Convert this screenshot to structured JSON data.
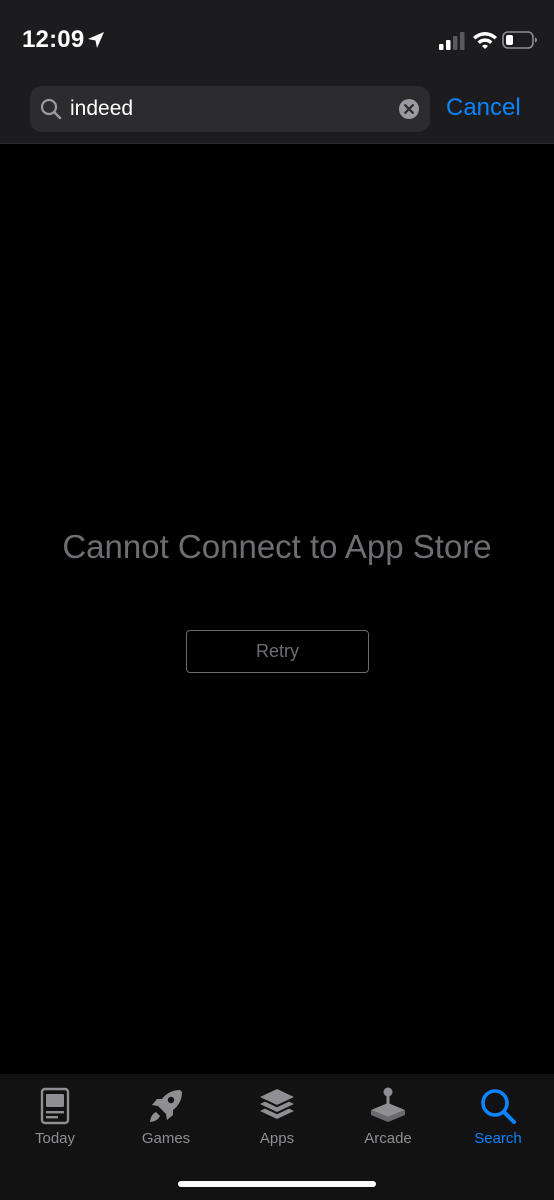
{
  "status_bar": {
    "time": "12:09",
    "icons": [
      "location-arrow-icon",
      "cellular-signal-icon",
      "wifi-icon",
      "battery-icon"
    ]
  },
  "search": {
    "query": "indeed",
    "cancel_label": "Cancel"
  },
  "main": {
    "error_title": "Cannot Connect to App Store",
    "retry_label": "Retry"
  },
  "tab_bar": {
    "tabs": [
      {
        "label": "Today",
        "icon": "today-icon"
      },
      {
        "label": "Games",
        "icon": "rocket-icon"
      },
      {
        "label": "Apps",
        "icon": "layers-icon"
      },
      {
        "label": "Arcade",
        "icon": "joystick-icon"
      },
      {
        "label": "Search",
        "icon": "search-icon"
      }
    ],
    "active": "Search"
  },
  "colors": {
    "accent": "#0a84ff",
    "background": "#000000",
    "bar_background": "#1c1c1e",
    "muted_text": "#6e6e72",
    "inactive_tab": "#8e8e93"
  }
}
